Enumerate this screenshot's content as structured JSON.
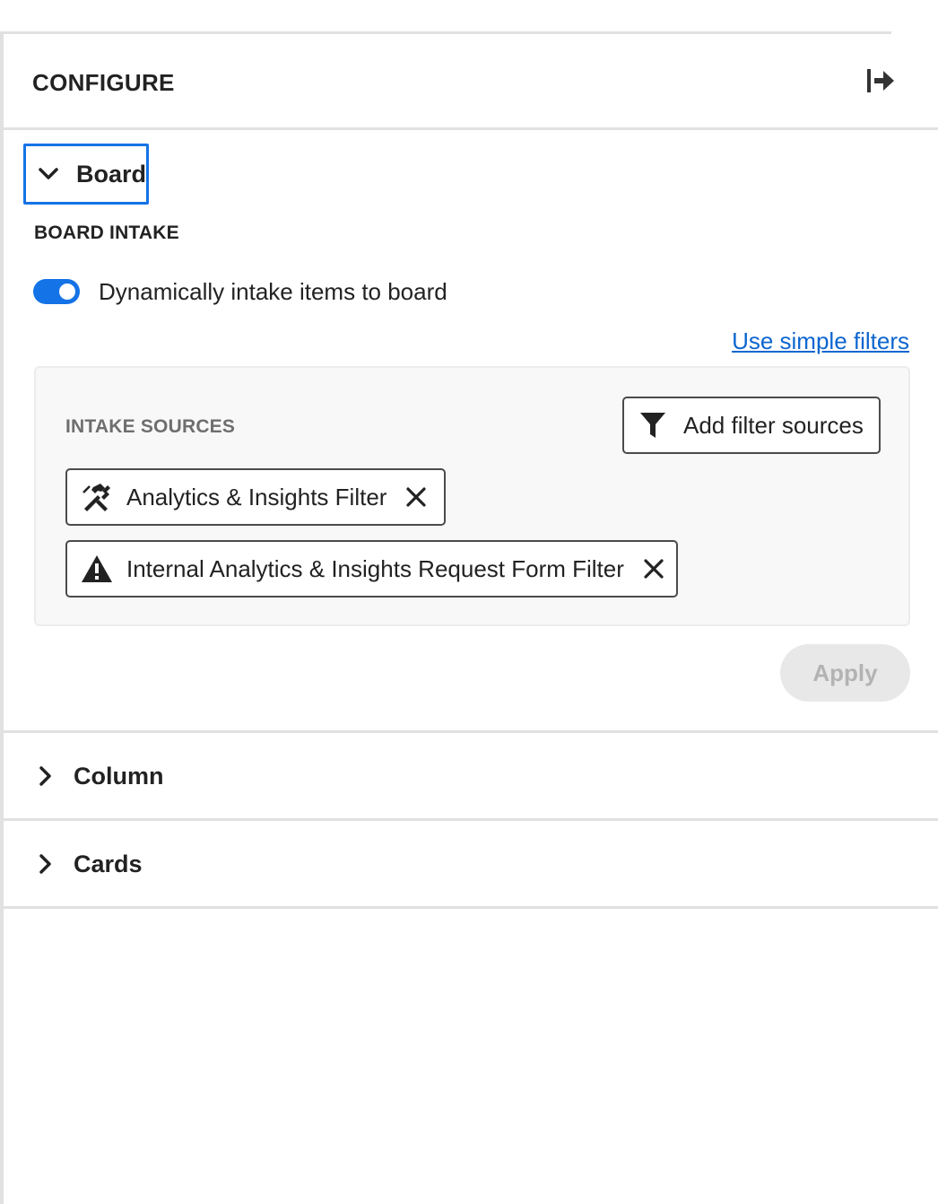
{
  "header": {
    "title": "CONFIGURE",
    "collapse_icon": "collapse-right-icon"
  },
  "board": {
    "label": "Board",
    "expanded": true,
    "intake_title": "BOARD INTAKE",
    "toggle": {
      "label": "Dynamically intake items to board",
      "on": true
    },
    "simple_filters_link": "Use simple filters",
    "intake_sources": {
      "title": "INTAKE SOURCES",
      "add_button_label": "Add filter sources",
      "add_button_icon": "funnel-icon",
      "chips": [
        {
          "label": "Analytics & Insights Filter",
          "icon": "hammer-wrench-icon"
        },
        {
          "label": "Internal Analytics & Insights Request Form Filter",
          "icon": "warning-icon"
        }
      ]
    },
    "apply_label": "Apply"
  },
  "sections": [
    {
      "label": "Column",
      "expanded": false
    },
    {
      "label": "Cards",
      "expanded": false
    }
  ],
  "colors": {
    "accent": "#1473e6",
    "link": "#0d66d0",
    "border": "#e1e1e1",
    "disabled_bg": "#e8e8e8",
    "disabled_text": "#b3b3b3"
  }
}
